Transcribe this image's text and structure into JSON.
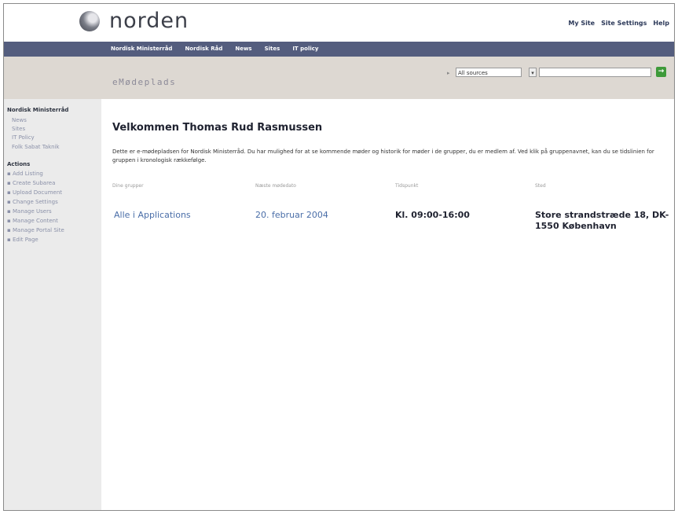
{
  "header": {
    "logo_text": "norden",
    "links": [
      "My Site",
      "Site Settings",
      "Help"
    ]
  },
  "nav": {
    "items": [
      "Nordisk Ministerråd",
      "Nordisk Råd",
      "News",
      "Sites",
      "IT policy"
    ]
  },
  "banner": {
    "site_title": "eMødeplads",
    "search_scope": "All sources",
    "search_value": ""
  },
  "sidebar": {
    "group_title": "Nordisk Ministerråd",
    "group_items": [
      "News",
      "Sites",
      "IT Policy",
      "Folk Sabat Taknik"
    ],
    "actions_title": "Actions",
    "actions": [
      "Add Listing",
      "Create Subarea",
      "Upload Document",
      "Change Settings",
      "Manage Users",
      "Manage Content",
      "Manage Portal Site",
      "Edit Page"
    ]
  },
  "main": {
    "welcome": "Velkommen Thomas Rud Rasmussen",
    "intro": "Dette er e-mødepladsen for Nordisk Ministerråd. Du har mulighed for at se kommende møder og historik for møder i de grupper, du er medlem af. Ved klik på gruppenavnet, kan du se tidslinien for gruppen i kronologisk rækkefølge.",
    "columns": [
      "Dine grupper",
      "Næste mødedato",
      "Tidspunkt",
      "Sted"
    ],
    "row": {
      "group": "Alle i Applications",
      "date": "20. februar 2004",
      "time": "Kl. 09:00-16:00",
      "place": "Store strandstræde 18, DK-1550 København"
    }
  },
  "colors": {
    "nav_bar": "#545d7e",
    "banner": "#ddd8d2",
    "sidebar": "#ebebeb",
    "link": "#4a6ea8",
    "go_button": "#3e9a3a"
  }
}
